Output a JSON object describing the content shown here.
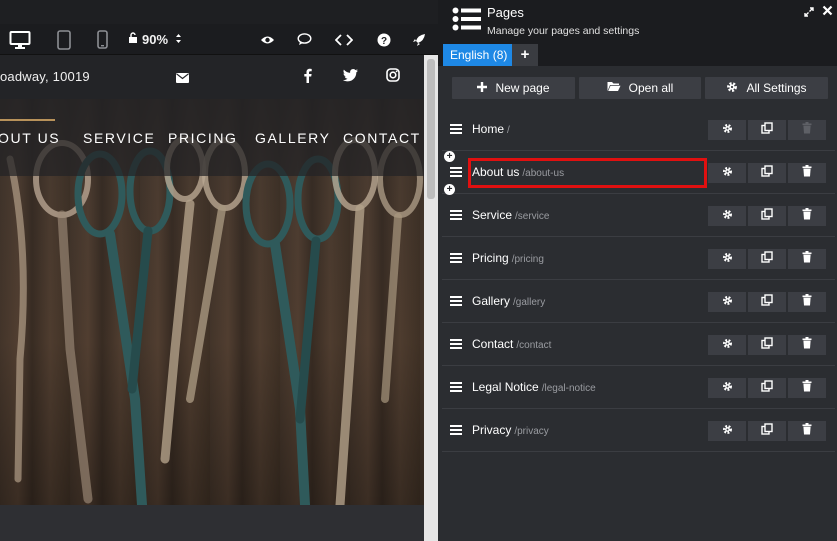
{
  "toolbar": {
    "zoom": "90%",
    "icons": [
      "desktop-icon",
      "tablet-icon",
      "mobile-icon",
      "lock-icon",
      "zoom-stepper-icon",
      "eye-icon",
      "comment-icon",
      "code-icon",
      "help-icon",
      "rocket-icon"
    ]
  },
  "site": {
    "address": "oadway, 10019",
    "nav": [
      "OUT US",
      "SERVICE",
      "PRICING",
      "GALLERY",
      "CONTACT"
    ]
  },
  "panel": {
    "title": "Pages",
    "subtitle": "Manage your pages and settings",
    "language_tab": "English (8)",
    "add_language": "+",
    "buttons": {
      "new_page": "New page",
      "open_all": "Open all",
      "all_settings": "All Settings"
    },
    "pages": [
      {
        "name": "Home",
        "slug": "/"
      },
      {
        "name": "About us",
        "slug": "/about-us"
      },
      {
        "name": "Service",
        "slug": "/service"
      },
      {
        "name": "Pricing",
        "slug": "/pricing"
      },
      {
        "name": "Gallery",
        "slug": "/gallery"
      },
      {
        "name": "Contact",
        "slug": "/contact"
      },
      {
        "name": "Legal Notice",
        "slug": "/legal-notice"
      },
      {
        "name": "Privacy",
        "slug": "/privacy"
      }
    ]
  },
  "colors": {
    "accent": "#1e88e5",
    "highlight": "#e01010",
    "panel_bg": "#2b2d31",
    "toolbar_bg": "#1b1c1f",
    "nav_underline": "#b8925a"
  }
}
